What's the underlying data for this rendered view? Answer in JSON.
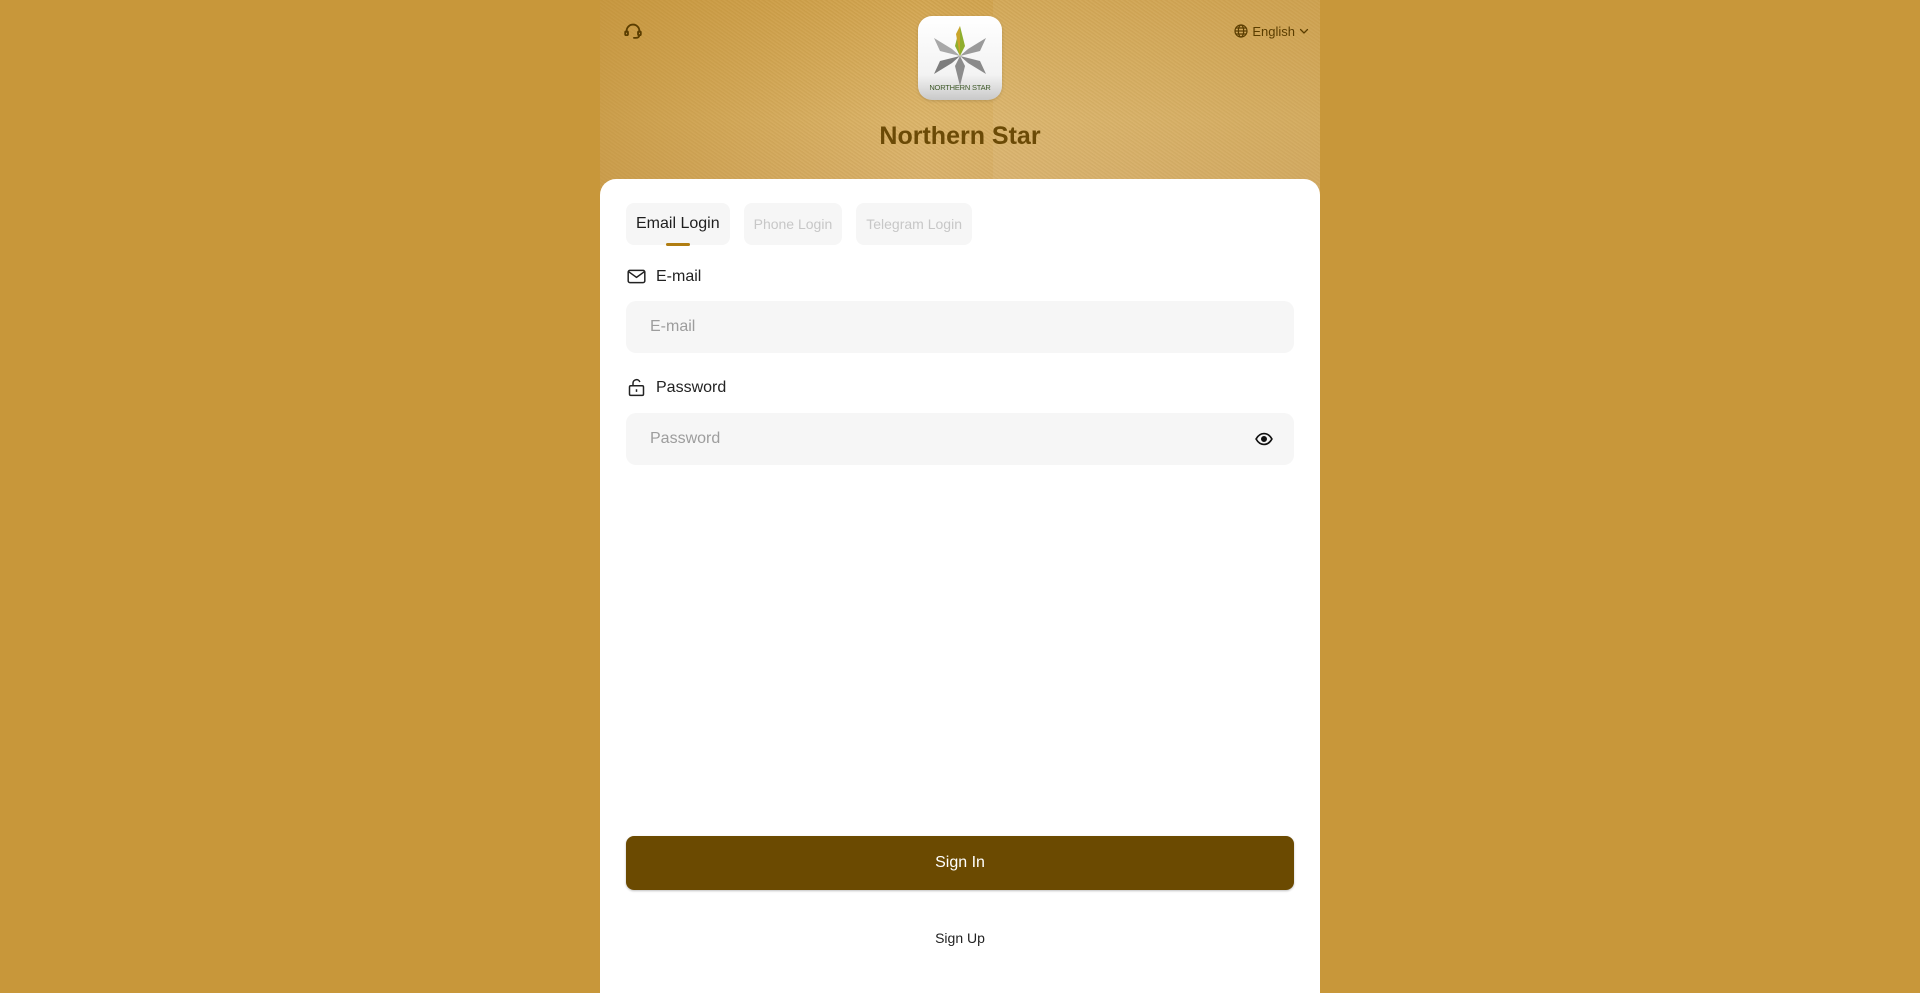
{
  "header": {
    "brand_name": "Northern Star",
    "logo_caption": "NORTHERN STAR",
    "language": "English"
  },
  "login_tabs": [
    {
      "label": "Email Login",
      "active": true
    },
    {
      "label": "Phone Login",
      "active": false
    },
    {
      "label": "Telegram Login",
      "active": false
    }
  ],
  "form": {
    "email_label": "E-mail",
    "email_placeholder": "E-mail",
    "email_value": "",
    "password_label": "Password",
    "password_placeholder": "Password",
    "password_value": ""
  },
  "actions": {
    "sign_in": "Sign In",
    "sign_up": "Sign Up"
  },
  "icons": {
    "support": "headset-icon",
    "language": "globe-icon",
    "dropdown": "chevron-down-icon",
    "email": "mail-icon",
    "password": "lock-icon",
    "visibility": "eye-icon"
  },
  "colors": {
    "page_background": "#c8973a",
    "brand_title": "#6b4a06",
    "primary_button": "#6b4a01",
    "active_tab_underline": "#b07d12"
  }
}
